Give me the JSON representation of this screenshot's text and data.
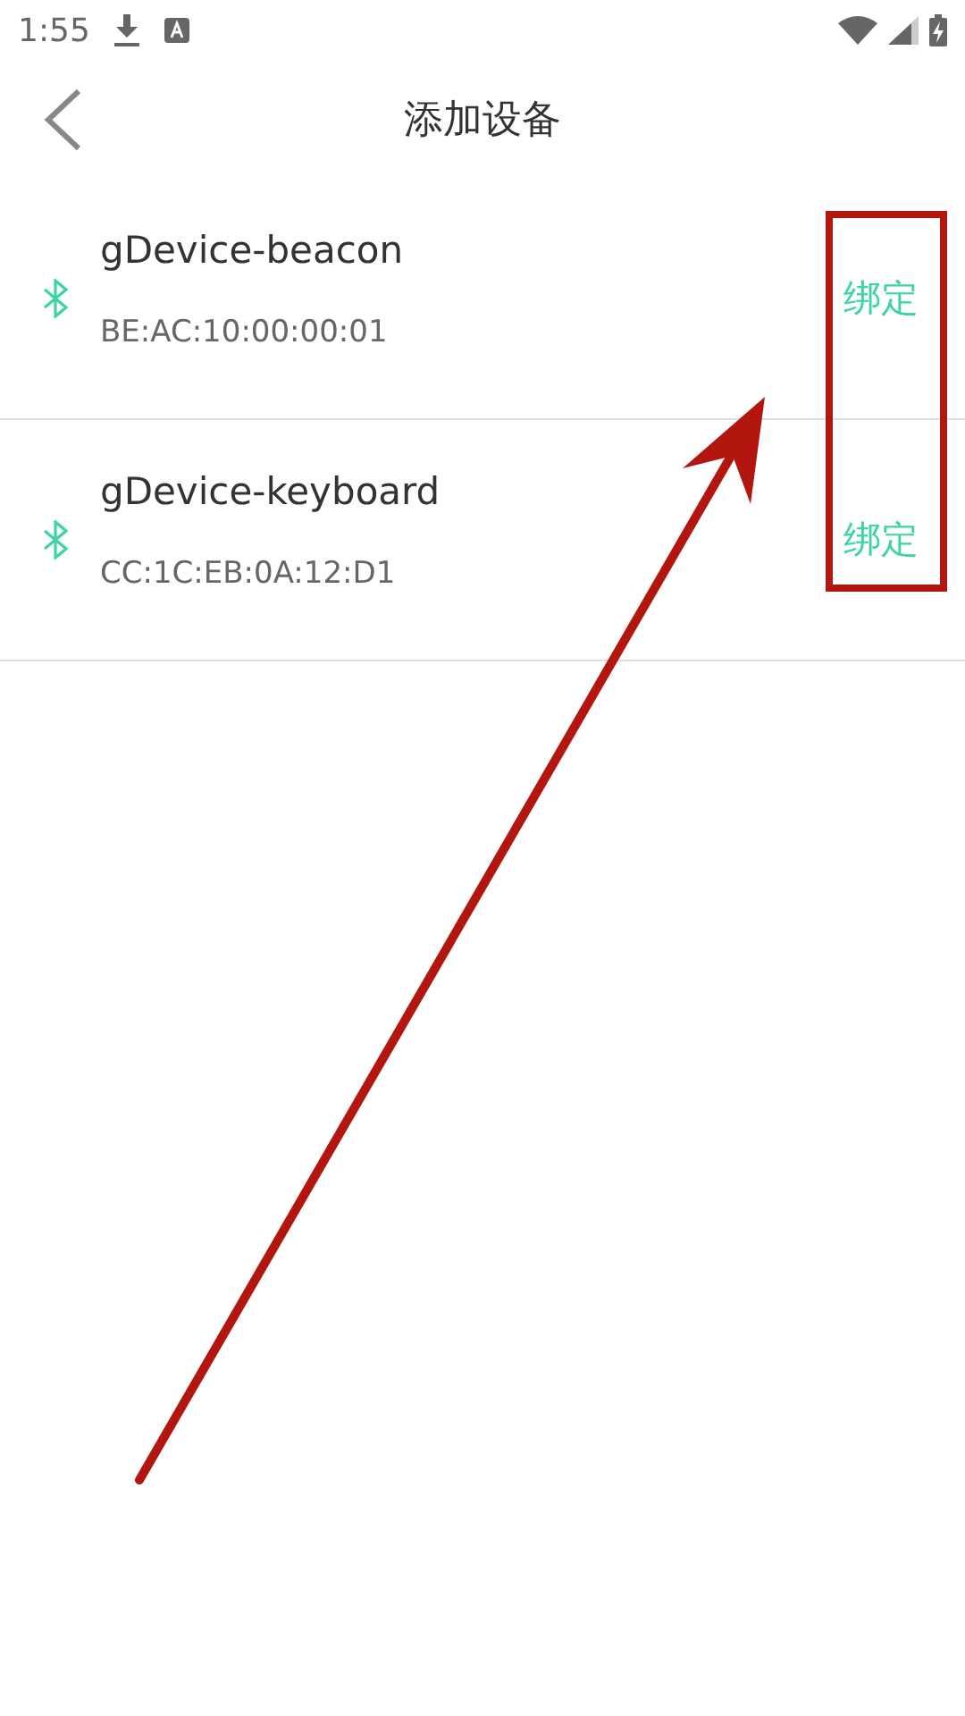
{
  "status_bar": {
    "time": "1:55"
  },
  "header": {
    "title": "添加设备"
  },
  "devices": [
    {
      "name": "gDevice-beacon",
      "address": "BE:AC:10:00:00:01",
      "action": "绑定"
    },
    {
      "name": "gDevice-keyboard",
      "address": "CC:1C:EB:0A:12:D1",
      "action": "绑定"
    }
  ]
}
